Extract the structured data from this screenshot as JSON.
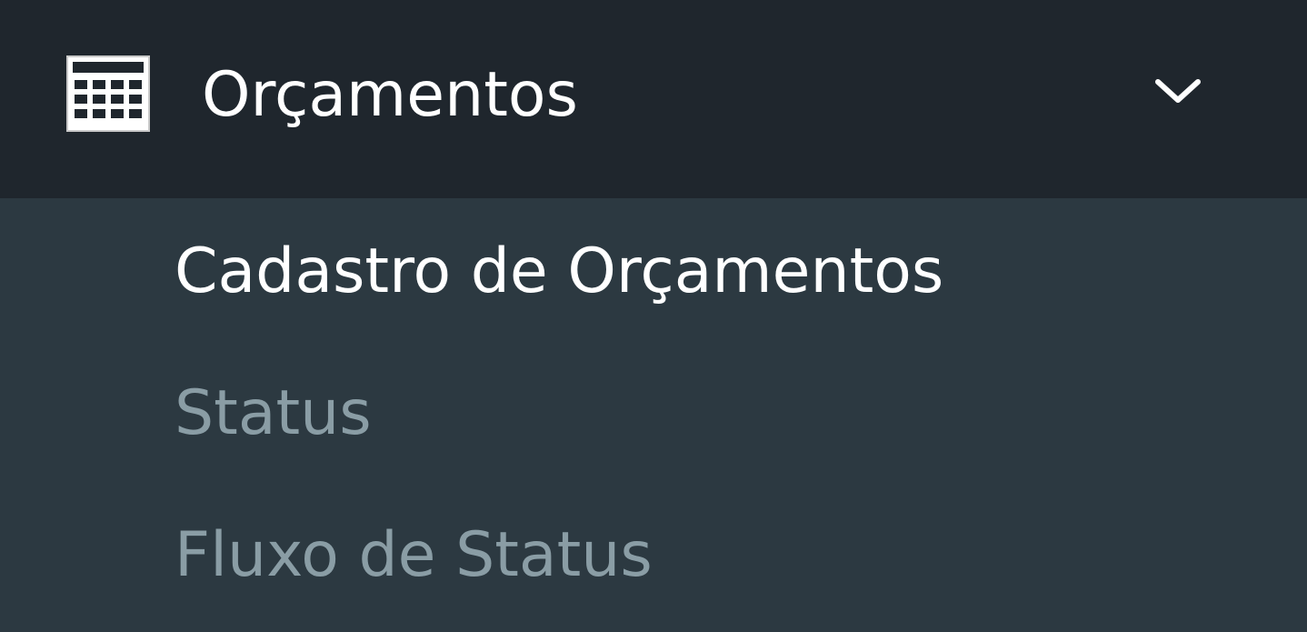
{
  "menu": {
    "header": {
      "icon": "calculator-icon",
      "label": "Orçamentos",
      "expand_icon": "chevron-down-icon",
      "expanded": true
    },
    "items": [
      {
        "label": "Cadastro de Orçamentos",
        "active": true
      },
      {
        "label": "Status",
        "active": false
      },
      {
        "label": "Fluxo de Status",
        "active": false
      }
    ]
  },
  "colors": {
    "header_background": "#1f262d",
    "submenu_background": "#2c3941",
    "active_text": "#ffffff",
    "inactive_text": "#8a9da5"
  }
}
